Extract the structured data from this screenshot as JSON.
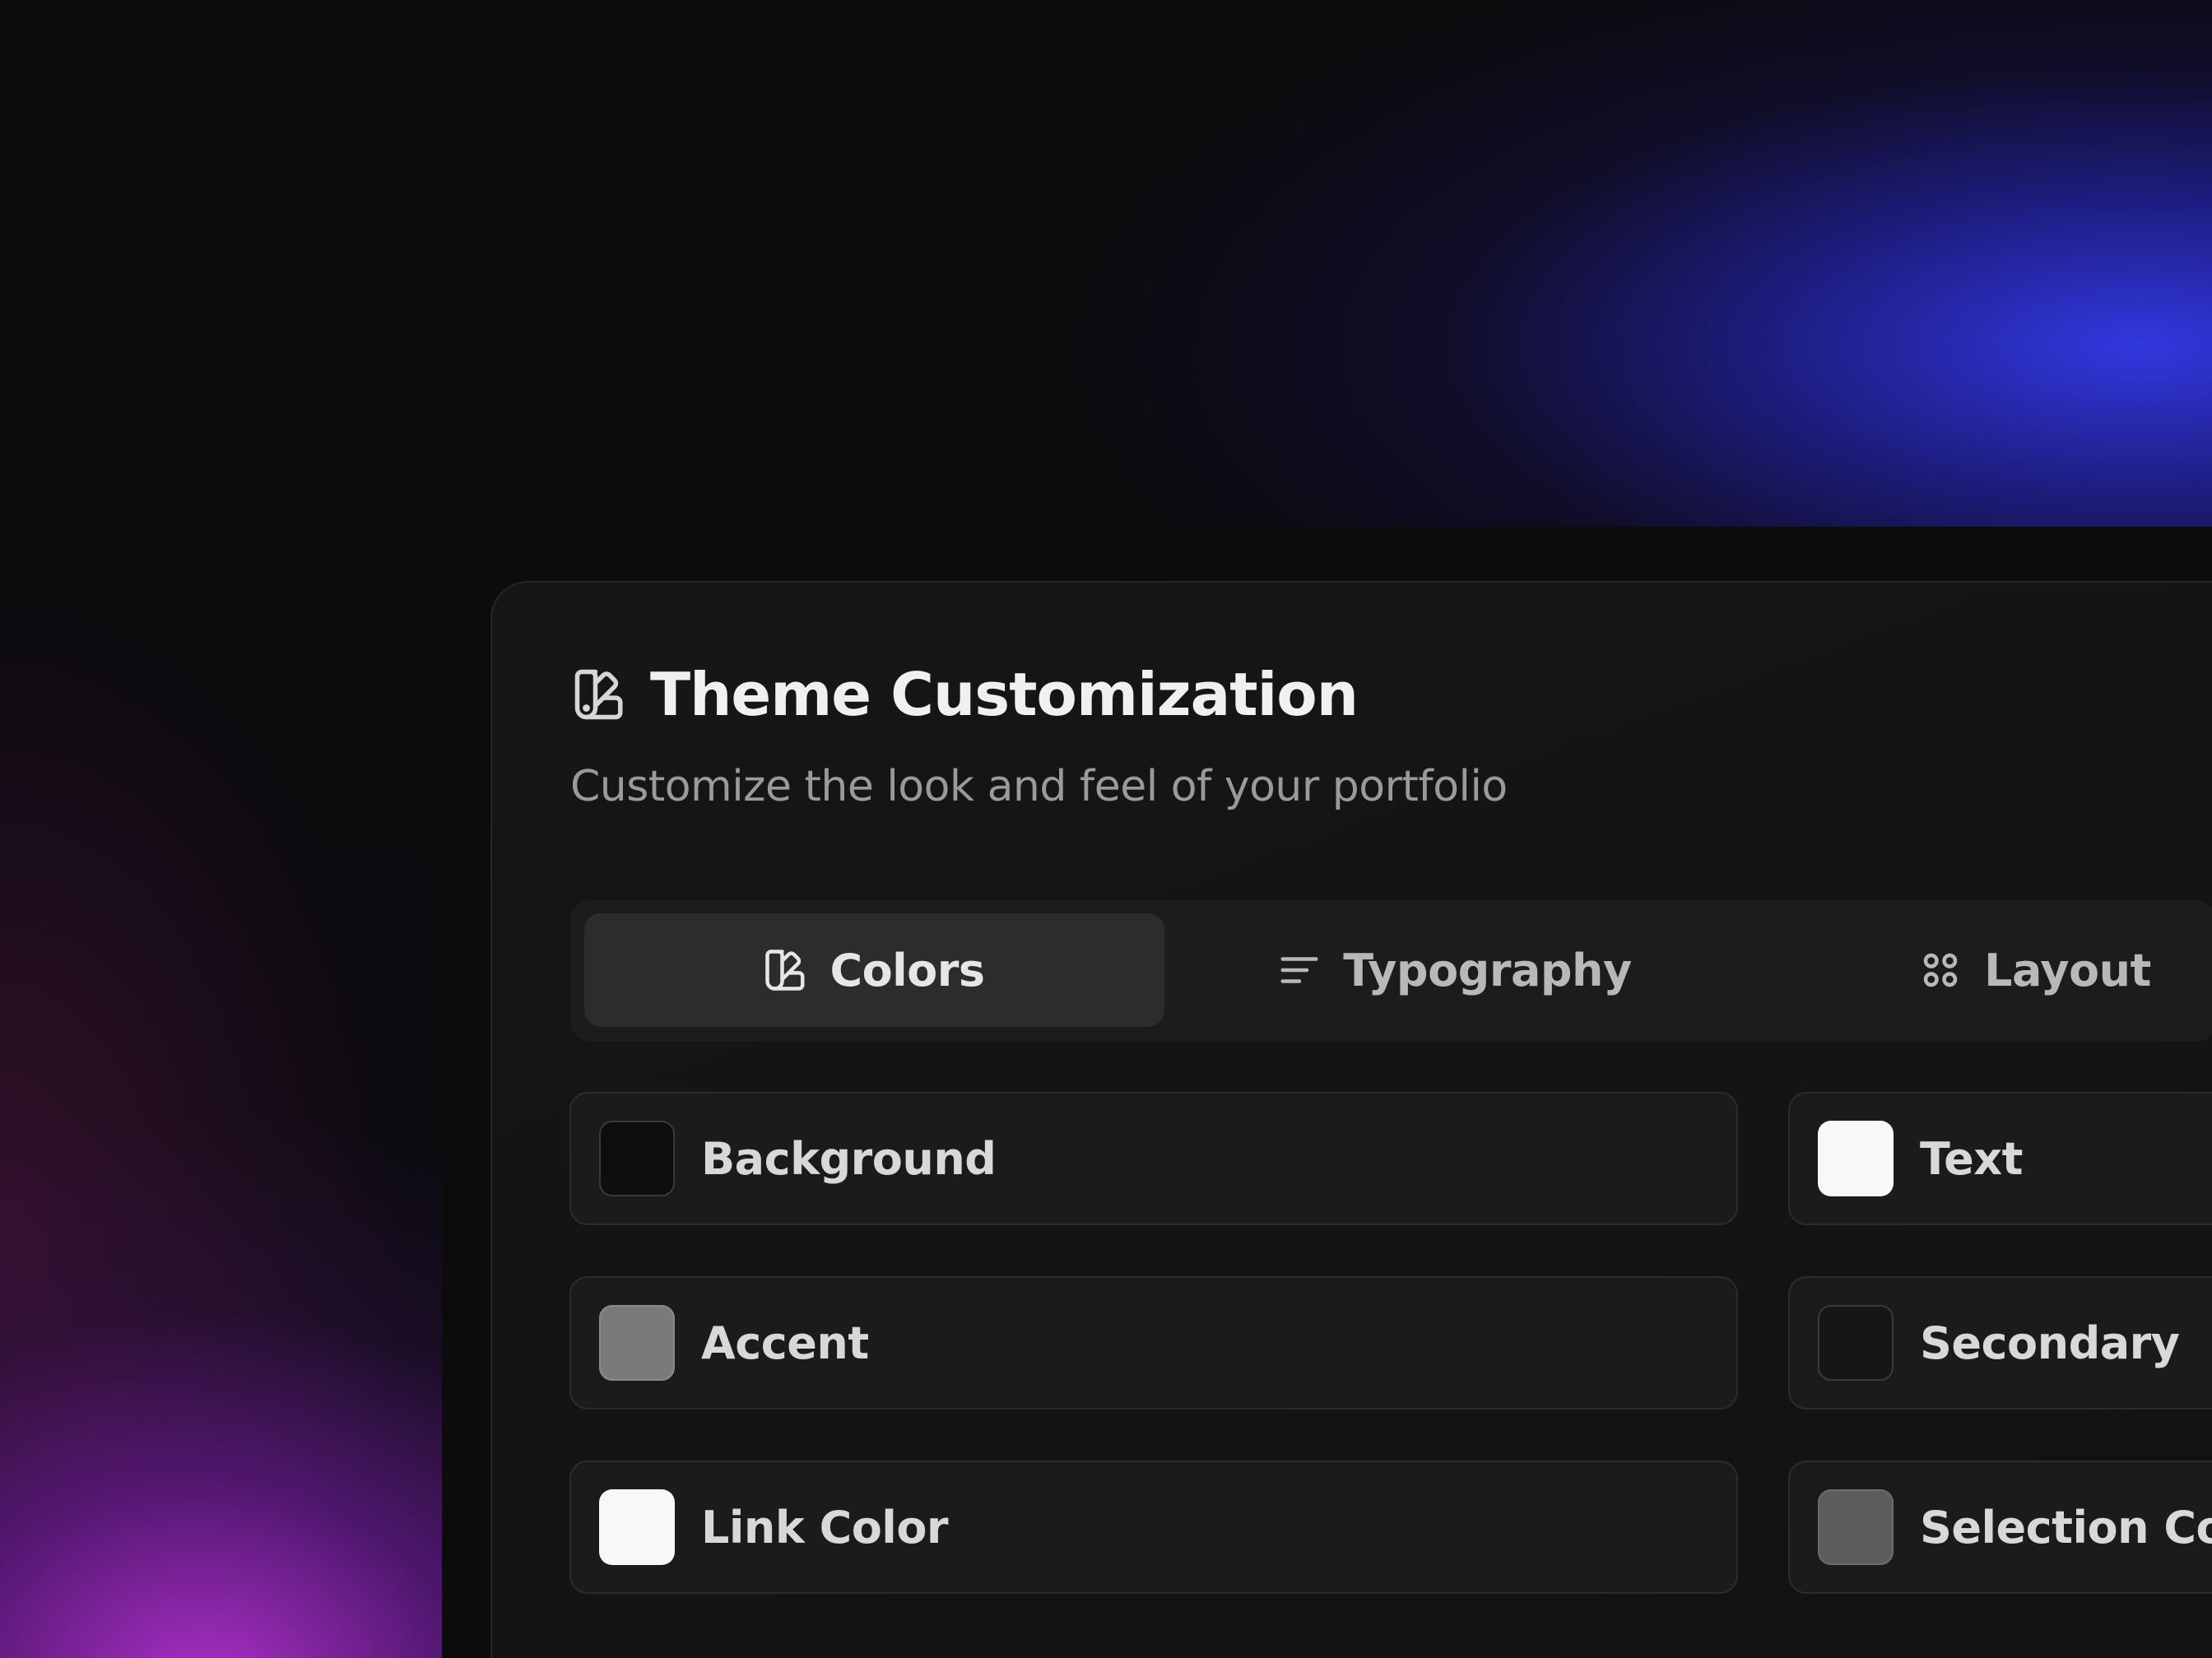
{
  "header": {
    "icon": "palette-icon",
    "title": "Theme Customization",
    "subtitle": "Customize the look and feel of your portfolio"
  },
  "tabs": [
    {
      "label": "Colors",
      "icon": "palette-icon",
      "active": true
    },
    {
      "label": "Typography",
      "icon": "text-align-icon",
      "active": false
    },
    {
      "label": "Layout",
      "icon": "grid-icon",
      "active": false
    }
  ],
  "colors": [
    {
      "label": "Background",
      "swatch": "#0e0e0e"
    },
    {
      "label": "Text",
      "swatch": "#f8f8f8"
    },
    {
      "label": "Accent",
      "swatch": "#7a7a7a"
    },
    {
      "label": "Secondary",
      "swatch": "#161616"
    },
    {
      "label": "Link Color",
      "swatch": "#f8f8f8"
    },
    {
      "label": "Selection Colo",
      "swatch": "#5c5c5c"
    }
  ],
  "theme": {
    "accent_glow_blue": "#3a3aeb",
    "accent_glow_purple": "#b432d2",
    "card_background": "#151517",
    "active_tab_background": "#2c2c2f"
  }
}
